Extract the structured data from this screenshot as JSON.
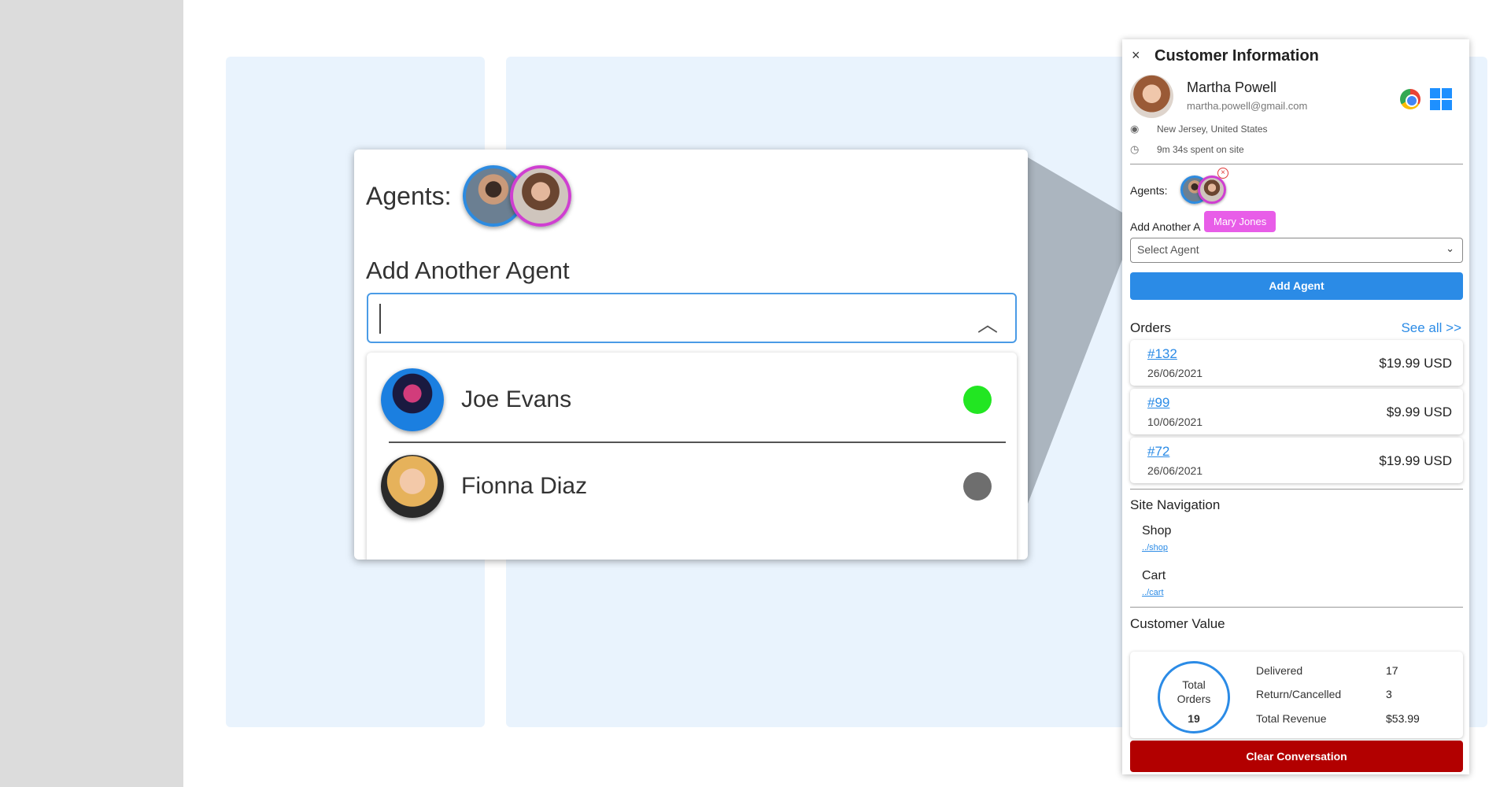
{
  "zoom": {
    "agents_label": "Agents:",
    "add_label": "Add Another Agent",
    "options": [
      {
        "name": "Joe Evans",
        "status_color": "#22e622"
      },
      {
        "name": "Fionna Diaz",
        "status_color": "#6e6e6e"
      }
    ]
  },
  "panel": {
    "title": "Customer Information",
    "close": "×",
    "customer": {
      "name": "Martha Powell",
      "email": "martha.powell@gmail.com",
      "location": "New Jersey, United States",
      "time_on_site": "9m 34s spent on site"
    },
    "agents_label": "Agents:",
    "add_another_label": "Add Another A",
    "tooltip": "Mary Jones",
    "select_placeholder": "Select Agent",
    "add_agent_button": "Add Agent",
    "orders_title": "Orders",
    "see_all": "See all >>",
    "orders": [
      {
        "id": "#132",
        "date": "26/06/2021",
        "price": "$19.99 USD"
      },
      {
        "id": "#99",
        "date": "10/06/2021",
        "price": "$9.99 USD"
      },
      {
        "id": "#72",
        "date": "26/06/2021",
        "price": "$19.99 USD"
      }
    ],
    "site_nav_title": "Site Navigation",
    "nav": [
      {
        "name": "Shop",
        "link": "../shop"
      },
      {
        "name": "Cart",
        "link": "../cart"
      }
    ],
    "customer_value_title": "Customer Value",
    "total_orders_label_1": "Total",
    "total_orders_label_2": "Orders",
    "total_orders": "19",
    "stats": [
      {
        "label": "Delivered",
        "value": "17"
      },
      {
        "label": "Return/Cancelled",
        "value": "3"
      },
      {
        "label": "Total Revenue",
        "value": "$53.99"
      }
    ],
    "clear_button": "Clear Conversation",
    "accent_color": "#2b8be6",
    "danger_color": "#b20000"
  }
}
